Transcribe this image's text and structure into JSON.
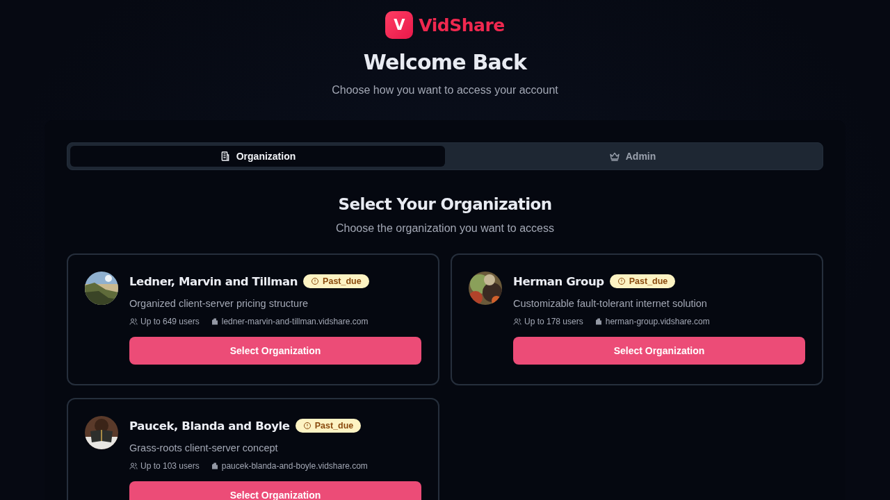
{
  "brand": {
    "mark": "V",
    "name": "VidShare"
  },
  "header": {
    "title": "Welcome Back",
    "subtitle": "Choose how you want to access your account"
  },
  "tabs": [
    {
      "label": "Organization",
      "selected": true
    },
    {
      "label": "Admin",
      "selected": false
    }
  ],
  "section": {
    "title": "Select Your Organization",
    "subtitle": "Choose the organization you want to access"
  },
  "organizations": [
    {
      "name": "Ledner, Marvin and Tillman",
      "status": "Past_due",
      "description": "Organized client-server pricing structure",
      "users": "Up to 649 users",
      "domain": "ledner-marvin-and-tillman.vidshare.com",
      "button": "Select Organization"
    },
    {
      "name": "Herman Group",
      "status": "Past_due",
      "description": "Customizable fault-tolerant internet solution",
      "users": "Up to 178 users",
      "domain": "herman-group.vidshare.com",
      "button": "Select Organization"
    },
    {
      "name": "Paucek, Blanda and Boyle",
      "status": "Past_due",
      "description": "Grass-roots client-server concept",
      "users": "Up to 103 users",
      "domain": "paucek-blanda-and-boyle.vidshare.com",
      "button": "Select Organization"
    }
  ]
}
